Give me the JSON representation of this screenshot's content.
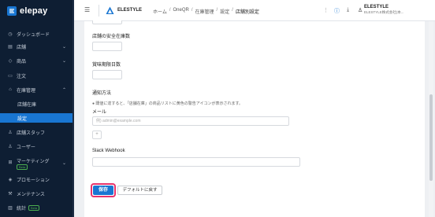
{
  "app": {
    "logo_text": "elepay",
    "brand_name": "ELESTYLE"
  },
  "sidebar": {
    "items": [
      {
        "label": "ダッシュボード",
        "icon": "clock-icon"
      },
      {
        "label": "店舗",
        "icon": "store-icon"
      },
      {
        "label": "商品",
        "icon": "tag-icon"
      },
      {
        "label": "注文",
        "icon": "receipt-icon"
      },
      {
        "label": "在庫管理",
        "icon": "warehouse-icon"
      },
      {
        "label": "店舗スタッフ",
        "icon": "person-icon"
      },
      {
        "label": "ユーザー",
        "icon": "person-icon"
      },
      {
        "label": "マーケティング",
        "icon": "gift-icon",
        "badge": "Beta"
      },
      {
        "label": "プロモーション",
        "icon": "tag-icon"
      },
      {
        "label": "メンテナンス",
        "icon": "wrench-icon"
      },
      {
        "label": "統計",
        "icon": "chart-icon",
        "badge": "Beta"
      }
    ],
    "subitems": [
      {
        "label": "店舗在庫"
      },
      {
        "label": "設定"
      }
    ]
  },
  "header": {
    "breadcrumb": [
      "ホーム",
      "OneQR",
      "在庫管理",
      "設定",
      "店舗別設定"
    ],
    "user_name": "ELESTYLE",
    "user_company": "ELESTYLE株式会社(本..."
  },
  "form": {
    "safety_stock_label": "店舗の安全在庫数",
    "expiry_days_label": "賞味期限日数",
    "notification_label": "通知方法",
    "notification_hint": "閾値に達すると、「店舗在庫」の商品リストに黄色の警告アイコンが表示されます。",
    "email_label": "メール",
    "email_placeholder": "例) admin@example.com",
    "plus_label": "+",
    "slack_label": "Slack Webhook",
    "save_label": "保存",
    "default_label": "デフォルトに戻す"
  },
  "colors": {
    "accent": "#1976d2",
    "highlight": "#e8336b",
    "sidebar_bg": "#0e1e33"
  }
}
